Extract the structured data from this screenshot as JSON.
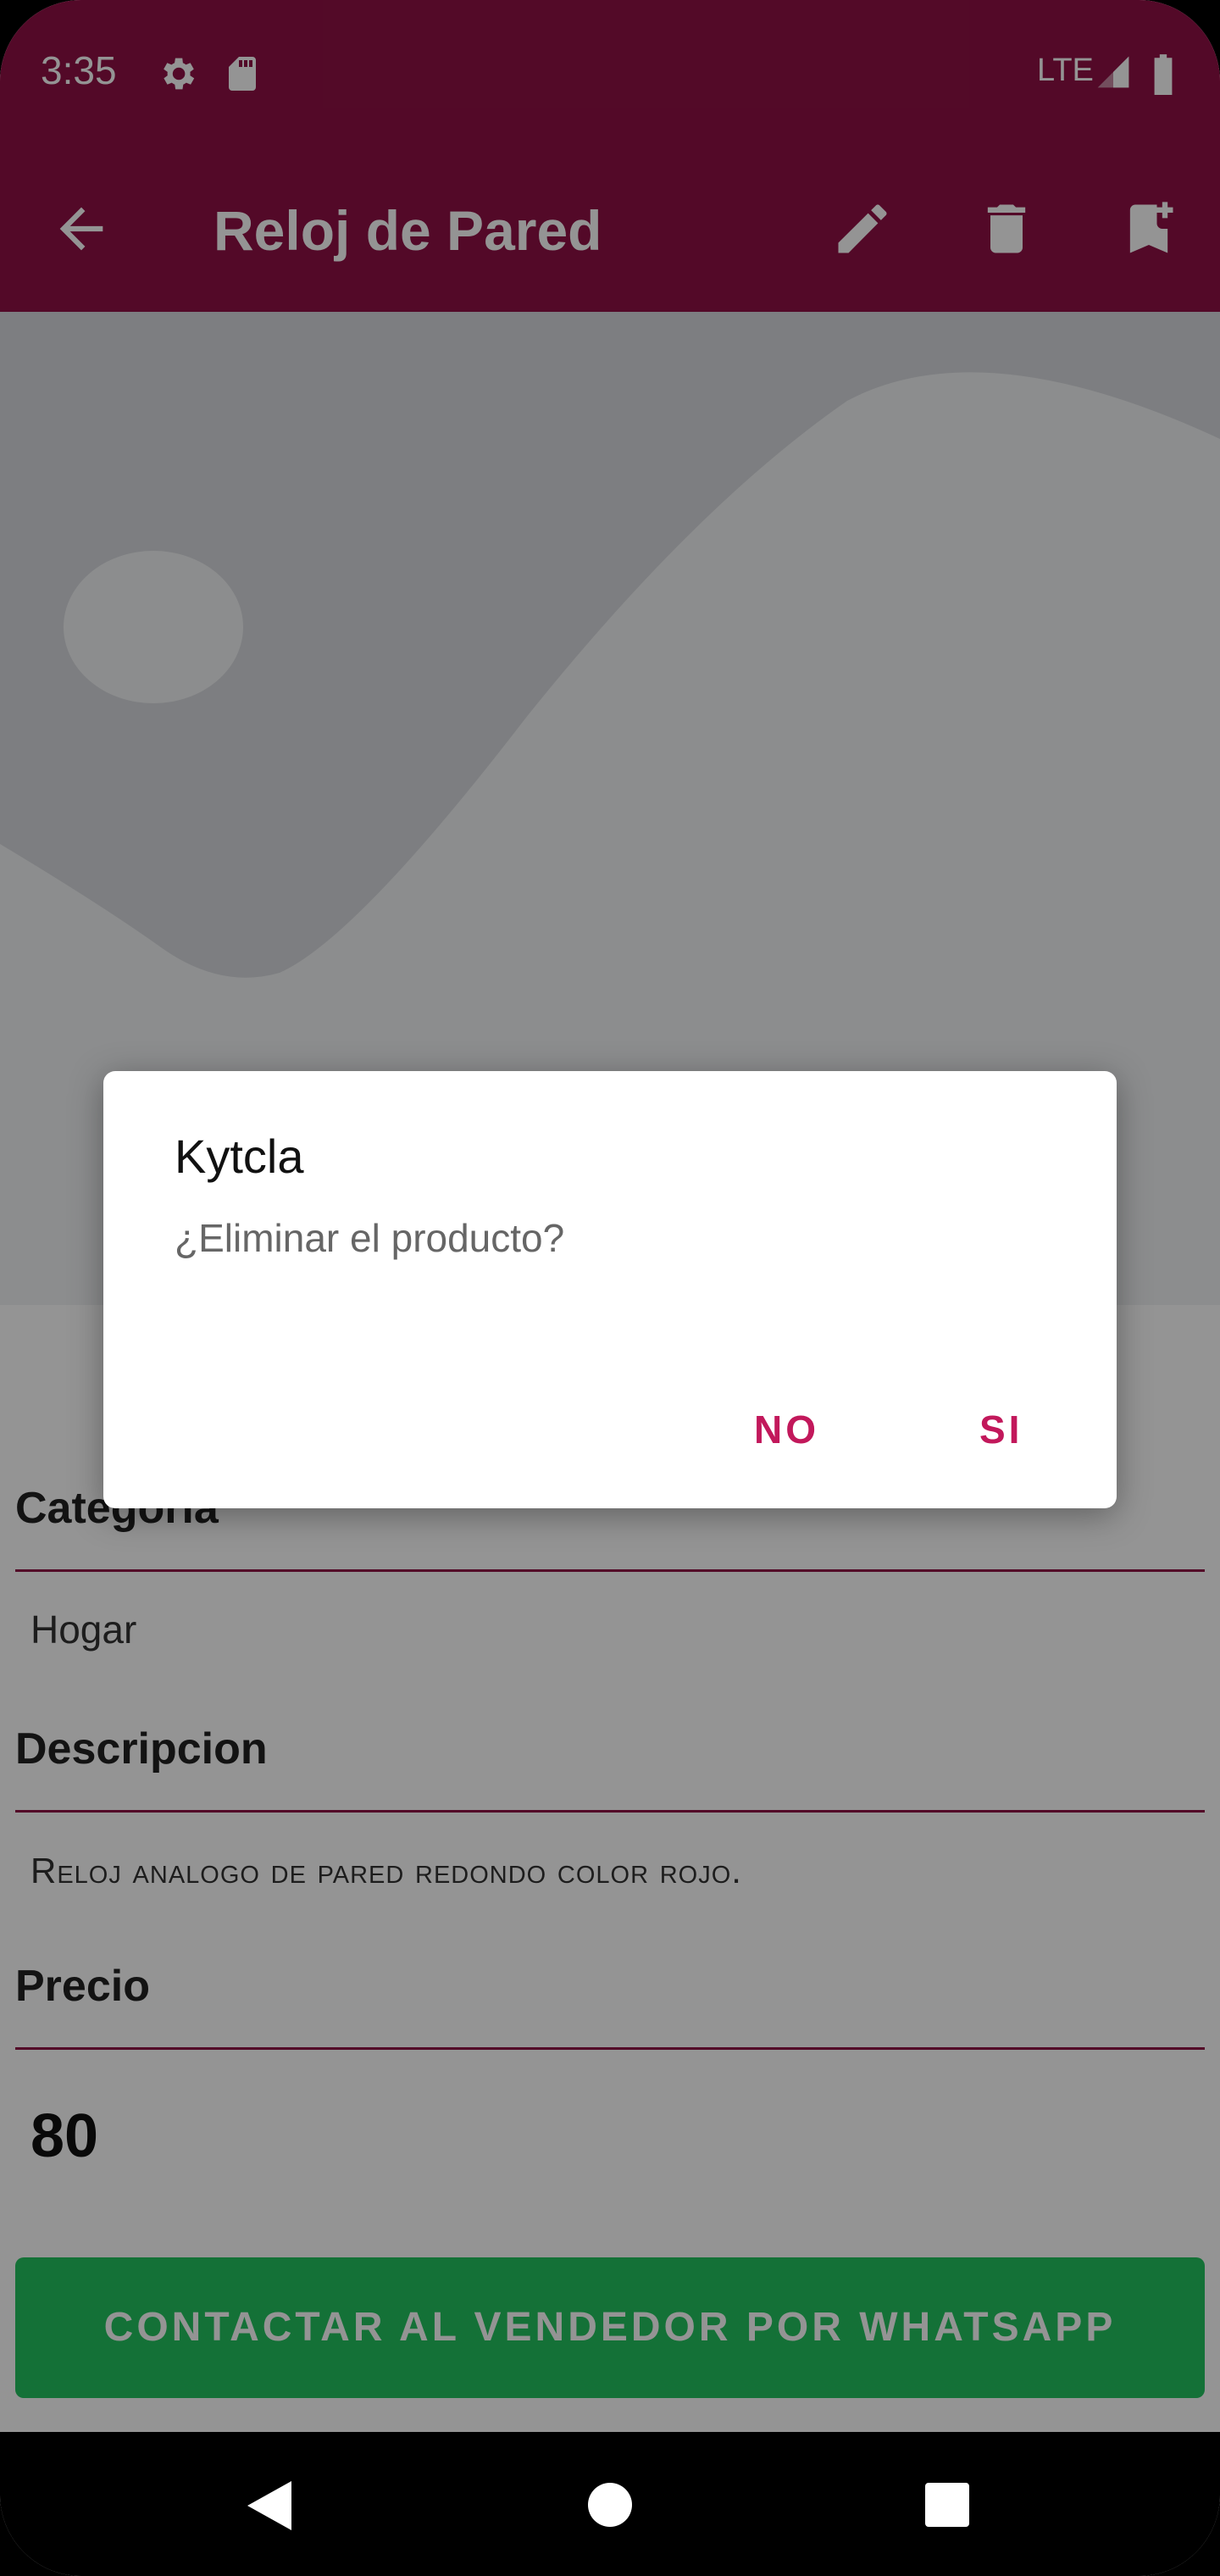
{
  "status_bar": {
    "time": "3:35",
    "network": "LTE"
  },
  "app_bar": {
    "title": "Reloj de Pared"
  },
  "product": {
    "category_label": "Categoria",
    "category_value": "Hogar",
    "description_label": "Descripcion",
    "description_value": "Reloj analogo de pared redondo color rojo.",
    "price_label": "Precio",
    "price_value": "80"
  },
  "contact_button": "CONTACTAR AL VENDEDOR POR WHATSAPP",
  "dialog": {
    "title": "Kytcla",
    "message": "¿Eliminar el producto?",
    "no_label": "NO",
    "yes_label": "SI"
  },
  "colors": {
    "primary": "#8f1145",
    "accent": "#c2185b",
    "whatsapp": "#23c35f"
  }
}
